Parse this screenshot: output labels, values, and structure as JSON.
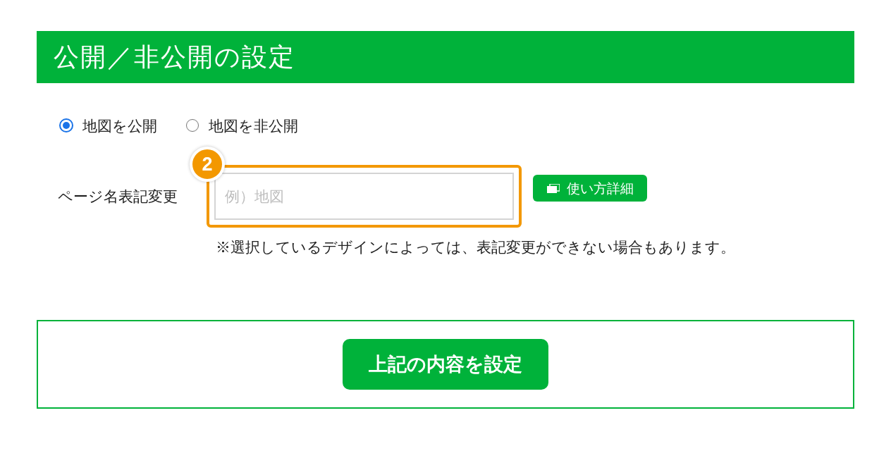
{
  "section": {
    "title": "公開／非公開の設定"
  },
  "visibility_options": [
    {
      "label": "地図を公開",
      "selected": true
    },
    {
      "label": "地図を非公開",
      "selected": false
    }
  ],
  "page_name_field": {
    "label": "ページ名表記変更",
    "placeholder": "例）地図",
    "highlighted": true,
    "callout_number": "2"
  },
  "help_button": {
    "label": "使い方詳細"
  },
  "note": "※選択しているデザインによっては、表記変更ができない場合もあります。",
  "submit_button": {
    "label": "上記の内容を設定"
  }
}
